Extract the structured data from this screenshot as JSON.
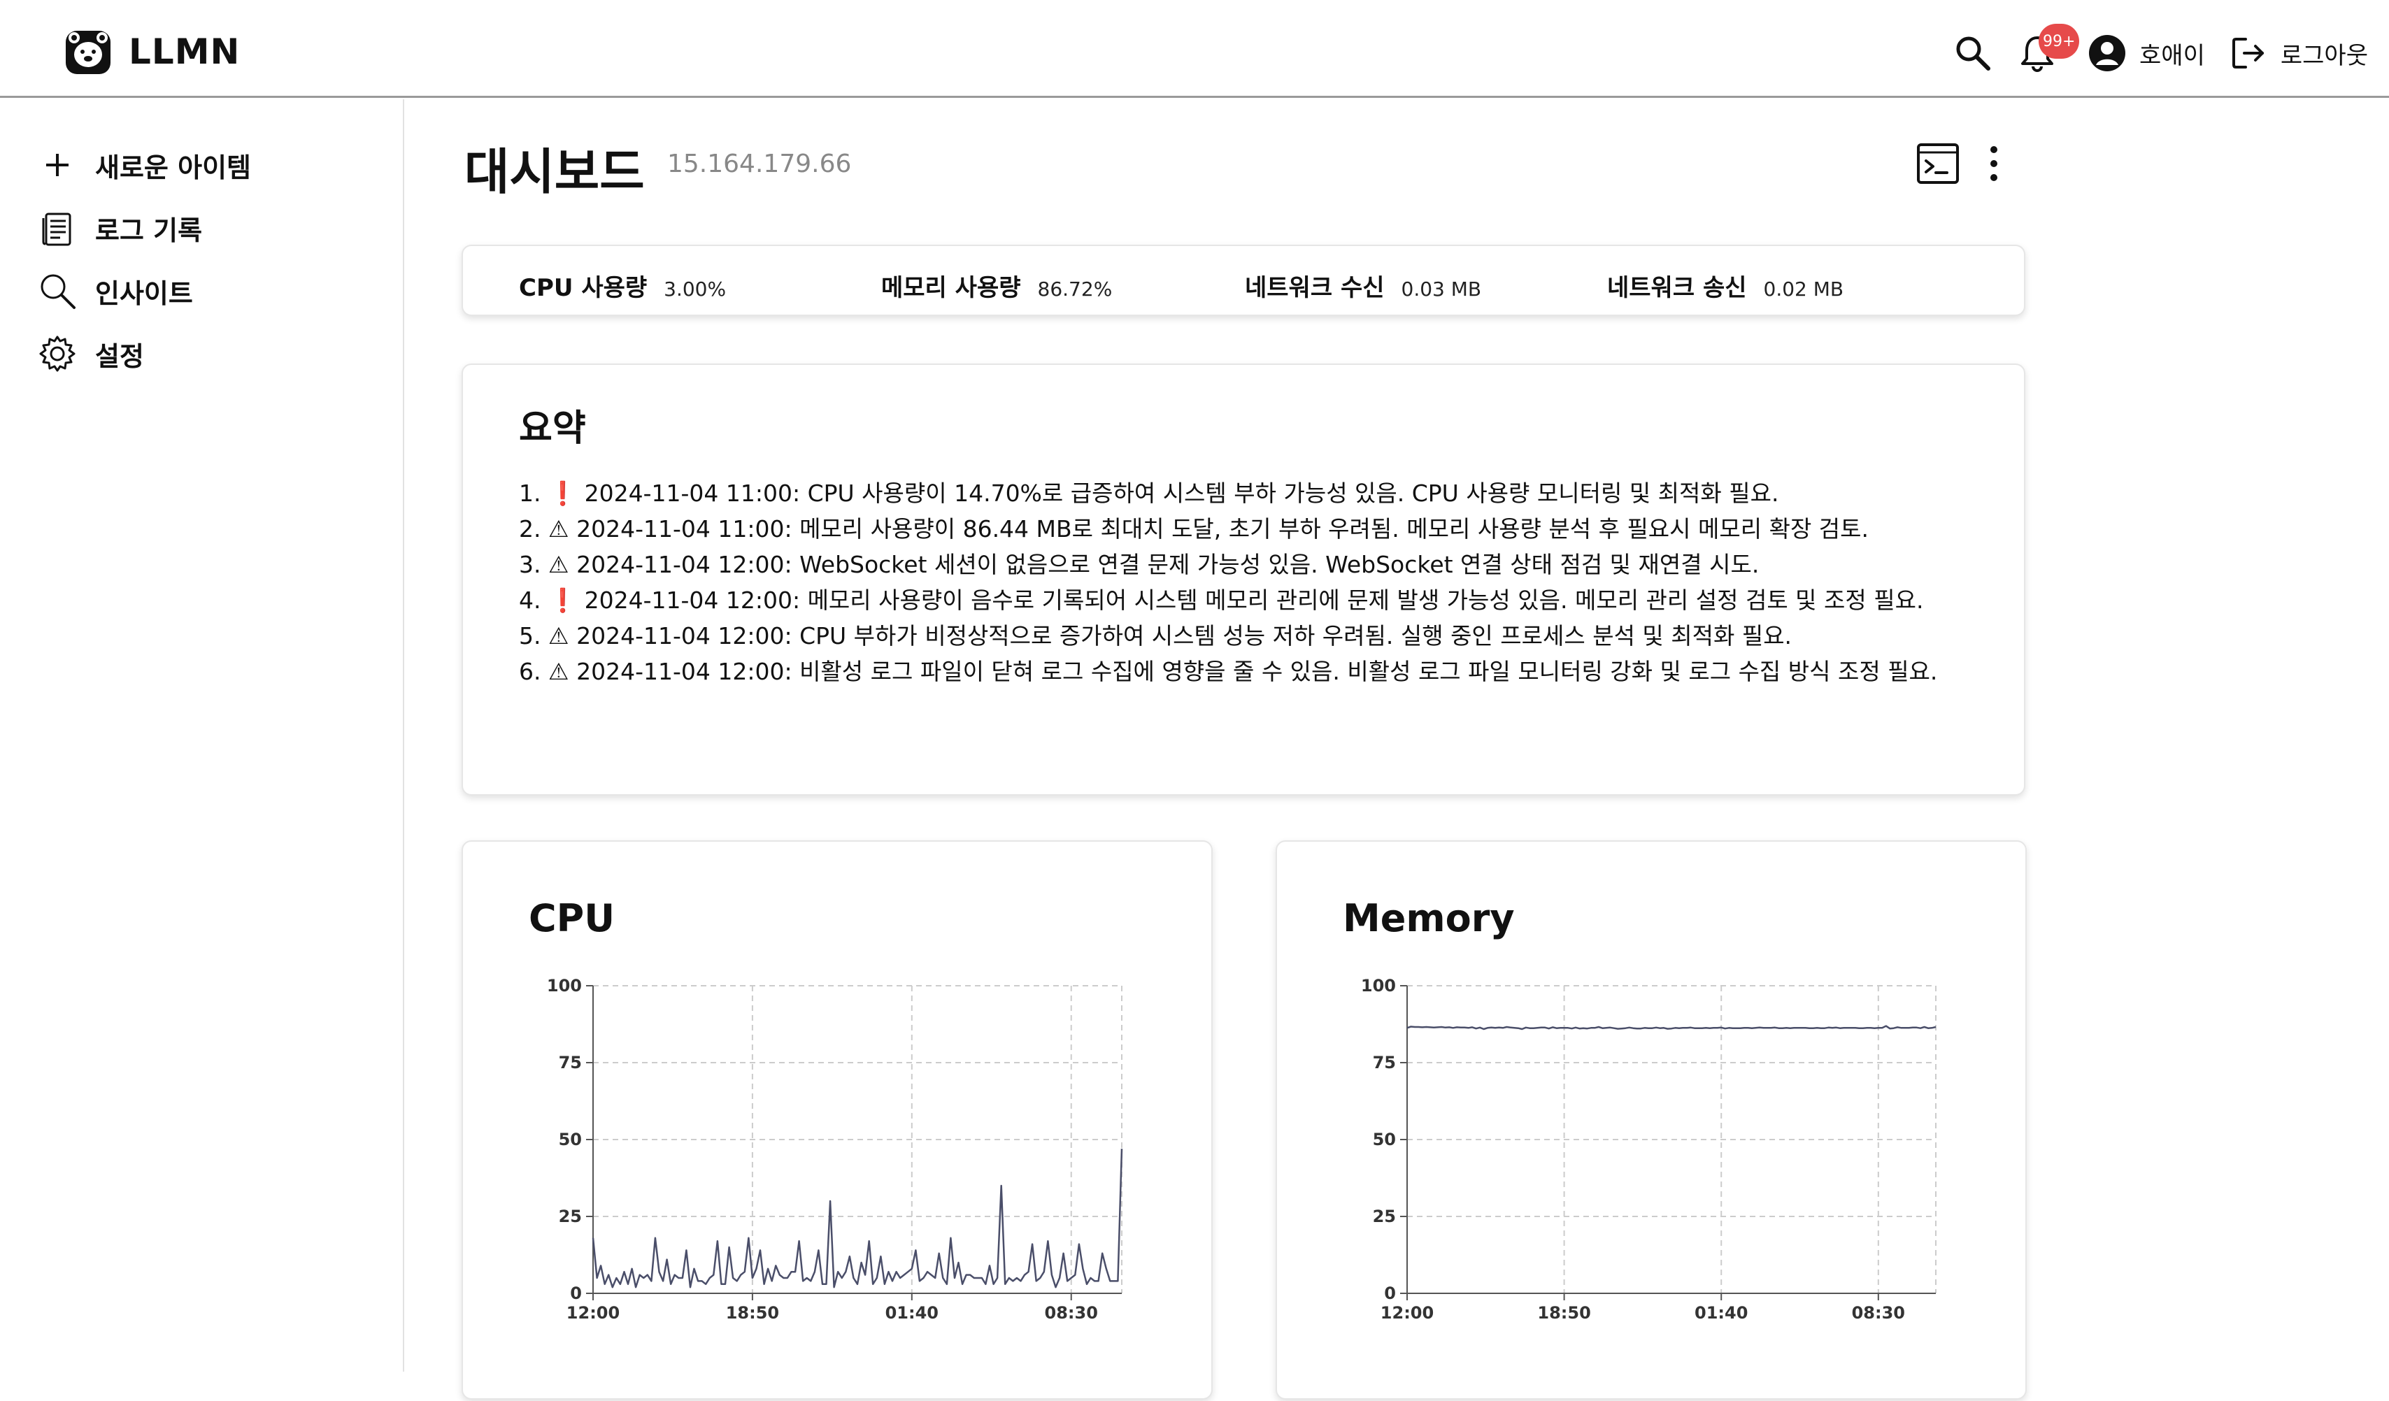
{
  "header": {
    "brand": "LLMN",
    "notification_badge": "99+",
    "user_name": "호애이",
    "logout_label": "로그아웃",
    "icons": [
      "search-icon",
      "bell-icon",
      "user-avatar-icon",
      "logout-icon"
    ]
  },
  "sidebar": {
    "items": [
      {
        "label": "새로운 아이템",
        "icon": "plus-icon"
      },
      {
        "label": "로그 기록",
        "icon": "document-icon"
      },
      {
        "label": "인사이트",
        "icon": "magnifier-icon"
      },
      {
        "label": "설정",
        "icon": "gear-icon"
      }
    ]
  },
  "page": {
    "title": "대시보드",
    "ip": "15.164.179.66",
    "icons": [
      "terminal-icon",
      "more-vertical-icon"
    ]
  },
  "stats": [
    {
      "label": "CPU 사용량",
      "value": "3.00%"
    },
    {
      "label": "메모리 사용량",
      "value": "86.72%"
    },
    {
      "label": "네트워크 수신",
      "value": "0.03 MB"
    },
    {
      "label": "네트워크 송신",
      "value": "0.02 MB"
    }
  ],
  "summary": {
    "title": "요약",
    "items": [
      {
        "num": "1.",
        "mark": "❗",
        "text": "2024-11-04 11:00: CPU 사용량이 14.70%로 급증하여 시스템 부하 가능성 있음. CPU 사용량 모니터링 및 최적화 필요."
      },
      {
        "num": "2.",
        "mark": "⚠",
        "text": "2024-11-04 11:00: 메모리 사용량이 86.44 MB로 최대치 도달, 초기 부하 우려됨. 메모리 사용량 분석 후 필요시 메모리 확장 검토."
      },
      {
        "num": "3.",
        "mark": "⚠",
        "text": "2024-11-04 12:00: WebSocket 세션이 없음으로 연결 문제 가능성 있음. WebSocket 연결 상태 점검 및 재연결 시도."
      },
      {
        "num": "4.",
        "mark": "❗",
        "text": "2024-11-04 12:00: 메모리 사용량이 음수로 기록되어 시스템 메모리 관리에 문제 발생 가능성 있음. 메모리 관리 설정 검토 및 조정 필요."
      },
      {
        "num": "5.",
        "mark": "⚠",
        "text": "2024-11-04 12:00: CPU 부하가 비정상적으로 증가하여 시스템 성능 저하 우려됨. 실행 중인 프로세스 분석 및 최적화 필요."
      },
      {
        "num": "6.",
        "mark": "⚠",
        "text": "2024-11-04 12:00: 비활성 로그 파일이 닫혀 로그 수집에 영향을 줄 수 있음. 비활성 로그 파일 모니터링 강화 및 로그 수집 방식 조정 필요."
      }
    ]
  },
  "colors": {
    "line": "#4a4e69",
    "grid": "#cccccc",
    "alert": "#d32121",
    "badge": "#e64a4a"
  },
  "chart_data": [
    {
      "type": "line",
      "title": "CPU",
      "xlabel": "",
      "ylabel": "",
      "ylim": [
        0,
        100
      ],
      "yticks": [
        0,
        25,
        50,
        75,
        100
      ],
      "xticks": [
        "12:00",
        "18:50",
        "01:40",
        "08:30"
      ],
      "xtick_index": [
        0,
        41,
        82,
        123
      ],
      "grid": true,
      "series": [
        {
          "values": [
            18,
            5,
            9,
            3,
            6,
            2,
            5,
            3,
            7,
            3,
            8,
            2,
            6,
            5,
            6,
            4,
            18,
            7,
            4,
            11,
            3,
            6,
            5,
            5,
            14,
            2,
            8,
            4,
            4,
            3,
            5,
            6,
            17,
            3,
            3,
            15,
            5,
            4,
            6,
            7,
            18,
            5,
            8,
            14,
            3,
            8,
            4,
            9,
            6,
            5,
            5,
            7,
            7,
            17,
            4,
            5,
            4,
            7,
            14,
            3,
            3,
            30,
            2,
            7,
            5,
            7,
            12,
            5,
            3,
            10,
            6,
            17,
            3,
            5,
            12,
            3,
            7,
            4,
            7,
            5,
            6,
            7,
            8,
            14,
            4,
            5,
            7,
            6,
            5,
            13,
            5,
            3,
            18,
            5,
            10,
            3,
            6,
            6,
            5,
            5,
            5,
            3,
            9,
            3,
            5,
            35,
            3,
            5,
            4,
            5,
            4,
            6,
            7,
            16,
            4,
            5,
            7,
            17,
            6,
            2,
            5,
            13,
            4,
            5,
            6,
            16,
            8,
            3,
            5,
            4,
            4,
            13,
            8,
            4,
            4,
            4,
            47
          ]
        }
      ]
    },
    {
      "type": "line",
      "title": "Memory",
      "xlabel": "",
      "ylabel": "",
      "ylim": [
        0,
        100
      ],
      "yticks": [
        0,
        25,
        50,
        75,
        100
      ],
      "xticks": [
        "12:00",
        "18:50",
        "01:40",
        "08:30"
      ],
      "xtick_index": [
        0,
        41,
        82,
        123
      ],
      "grid": true,
      "series": [
        {
          "values": [
            86.3,
            86.7,
            86.6,
            86.6,
            86.5,
            86.6,
            86.5,
            86.4,
            86.5,
            86.6,
            86.4,
            86.5,
            86.3,
            86.5,
            86.4,
            86.4,
            86.3,
            86.5,
            86.1,
            86.4,
            85.9,
            86.3,
            86.4,
            86.3,
            86.4,
            86.3,
            86.6,
            86.4,
            86.3,
            86.2,
            85.9,
            86.4,
            86.2,
            86.2,
            86.3,
            86.4,
            86.4,
            86.1,
            86.5,
            86.2,
            86.3,
            86.3,
            86.3,
            86.1,
            86.4,
            86.1,
            86.2,
            86.1,
            86.3,
            86.3,
            86.6,
            86.2,
            86.3,
            86.4,
            86.2,
            86.0,
            86.1,
            86.2,
            86.4,
            86.2,
            86.1,
            86.1,
            86.3,
            86.2,
            86.2,
            86.4,
            86.2,
            86.3,
            86.0,
            86.1,
            86.3,
            86.2,
            86.3,
            86.3,
            86.4,
            86.2,
            86.2,
            86.2,
            86.3,
            86.2,
            86.3,
            86.3,
            86.4,
            86.1,
            86.3,
            86.2,
            86.2,
            86.2,
            86.3,
            86.3,
            86.2,
            86.3,
            86.4,
            86.3,
            86.3,
            86.3,
            86.4,
            86.2,
            86.2,
            86.3,
            86.2,
            86.3,
            86.3,
            86.3,
            86.3,
            86.2,
            86.2,
            86.3,
            86.2,
            86.2,
            86.4,
            86.3,
            86.4,
            86.2,
            86.3,
            86.3,
            86.3,
            86.3,
            86.2,
            86.2,
            86.3,
            86.3,
            86.2,
            86.3,
            86.3,
            86.9,
            86.1,
            86.2,
            86.5,
            86.3,
            86.3,
            86.3,
            86.4,
            86.4,
            86.2,
            86.6,
            86.2,
            86.3,
            86.6
          ]
        }
      ]
    }
  ]
}
